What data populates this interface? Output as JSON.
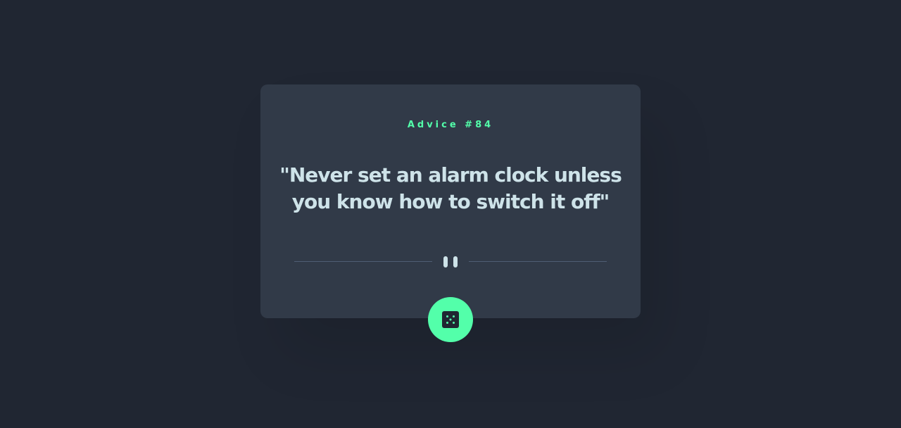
{
  "advice": {
    "id_label": "Advice #84",
    "text": "\"Never set an alarm clock unless you know how to switch it off\""
  },
  "divider": {
    "icon": "pause-icon"
  },
  "button": {
    "icon": "dice-icon",
    "color": "#53ffaa"
  },
  "colors": {
    "background": "#202632",
    "card": "#313a48",
    "accent": "#53ffaa",
    "text": "#cee3e9",
    "divider": "#4f5d74"
  }
}
